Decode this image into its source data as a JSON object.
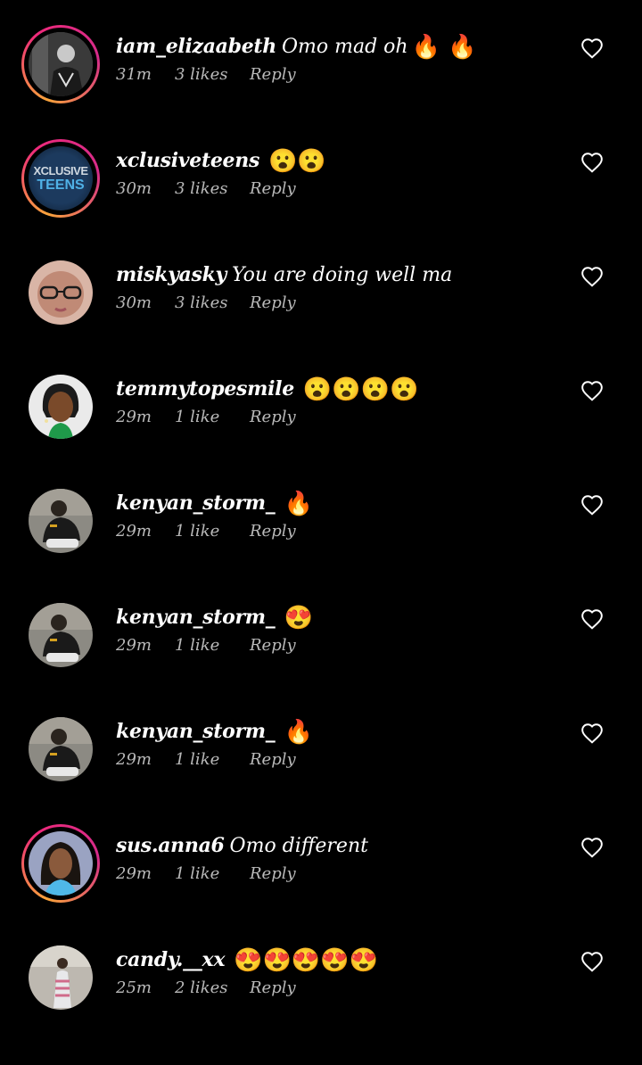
{
  "colors": {
    "background": "#000000",
    "text": "#ffffff",
    "meta_text": "#b9b9b9",
    "story_ring_start": "#f9a33b",
    "story_ring_end": "#ee2a7b"
  },
  "icons": {
    "like": "heart-outline-icon"
  },
  "comments": [
    {
      "username": "iam_elizaabeth",
      "text": "Omo mad oh",
      "emoji": "🔥 🔥",
      "time": "31m",
      "likes": "3 likes",
      "reply": "Reply",
      "has_story_ring": true
    },
    {
      "username": "xclusiveteens",
      "text": "",
      "emoji": "😮😮",
      "time": "30m",
      "likes": "3 likes",
      "reply": "Reply",
      "has_story_ring": true,
      "avatar_label_top": "XCLUSIVE",
      "avatar_label_bottom": "TEENS"
    },
    {
      "username": "miskyasky",
      "text": "You are doing well ma",
      "emoji": "",
      "time": "30m",
      "likes": "3 likes",
      "reply": "Reply",
      "has_story_ring": false
    },
    {
      "username": "temmytopesmile",
      "text": "",
      "emoji": "😮😮😮😮",
      "time": "29m",
      "likes": "1 like",
      "reply": "Reply",
      "has_story_ring": false
    },
    {
      "username": "kenyan_storm_",
      "text": "",
      "emoji": "🔥",
      "time": "29m",
      "likes": "1 like",
      "reply": "Reply",
      "has_story_ring": false
    },
    {
      "username": "kenyan_storm_",
      "text": "",
      "emoji": "😍",
      "time": "29m",
      "likes": "1 like",
      "reply": "Reply",
      "has_story_ring": false
    },
    {
      "username": "kenyan_storm_",
      "text": "",
      "emoji": "🔥",
      "time": "29m",
      "likes": "1 like",
      "reply": "Reply",
      "has_story_ring": false
    },
    {
      "username": "sus.anna6",
      "text": "Omo different",
      "emoji": "",
      "time": "29m",
      "likes": "1 like",
      "reply": "Reply",
      "has_story_ring": true
    },
    {
      "username": "candy.__xx",
      "text": "",
      "emoji": "😍😍😍😍😍",
      "time": "25m",
      "likes": "2 likes",
      "reply": "Reply",
      "has_story_ring": false
    }
  ]
}
